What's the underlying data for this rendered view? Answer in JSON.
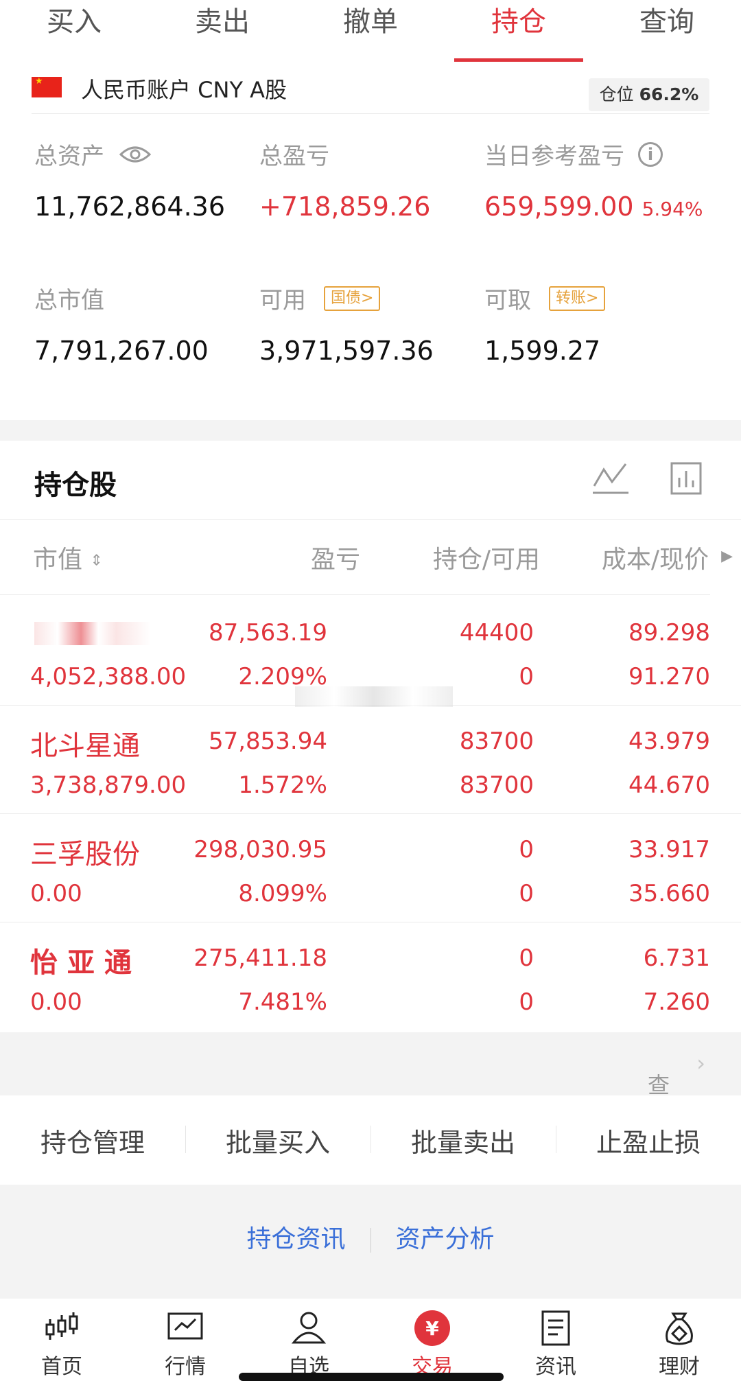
{
  "tabs": [
    {
      "label": "买入"
    },
    {
      "label": "卖出"
    },
    {
      "label": "撤单"
    },
    {
      "label": "持仓"
    },
    {
      "label": "查询"
    }
  ],
  "active_tab": "持仓",
  "account": {
    "label": "人民币账户 CNY A股",
    "position_label": "仓位",
    "position_value": "66.2%"
  },
  "summary": {
    "total_assets_label": "总资产",
    "total_assets": "11,762,864.36",
    "total_pl_label": "总盈亏",
    "total_pl": "+718,859.26",
    "daily_pl_label": "当日参考盈亏",
    "daily_pl": "659,599.00",
    "daily_pl_pct": "5.94%",
    "market_value_label": "总市值",
    "market_value": "7,791,267.00",
    "available_label": "可用",
    "available_tag": "国债>",
    "available": "3,971,597.36",
    "withdrawable_label": "可取",
    "withdrawable_tag": "转账>",
    "withdrawable": "1,599.27"
  },
  "holdings": {
    "title": "持仓股",
    "columns": [
      "市值",
      "盈亏",
      "持仓/可用",
      "成本/现价"
    ],
    "rows": [
      {
        "name": "",
        "market_value": "4,052,388.00",
        "pl": "87,563.19",
        "pl_pct": "2.209%",
        "position": "44400",
        "available": "0",
        "cost": "89.298",
        "price": "91.270"
      },
      {
        "name": "北斗星通",
        "market_value": "3,738,879.00",
        "pl": "57,853.94",
        "pl_pct": "1.572%",
        "position": "83700",
        "available": "83700",
        "cost": "43.979",
        "price": "44.670"
      },
      {
        "name": "三孚股份",
        "market_value": "0.00",
        "pl": "298,030.95",
        "pl_pct": "8.099%",
        "position": "0",
        "available": "0",
        "cost": "33.917",
        "price": "35.660"
      },
      {
        "name": "怡 亚 通",
        "market_value": "0.00",
        "pl": "275,411.18",
        "pl_pct": "7.481%",
        "position": "0",
        "available": "0",
        "cost": "6.731",
        "price": "7.260"
      }
    ],
    "cleared_link": "查看已清仓股票"
  },
  "actions": [
    "持仓管理",
    "批量买入",
    "批量卖出",
    "止盈止损"
  ],
  "links": [
    "持仓资讯",
    "资产分析"
  ],
  "nav": [
    {
      "label": "首页",
      "icon": "candlestick-icon"
    },
    {
      "label": "行情",
      "icon": "chart-icon"
    },
    {
      "label": "自选",
      "icon": "person-icon"
    },
    {
      "label": "交易",
      "icon": "yuan-icon"
    },
    {
      "label": "资讯",
      "icon": "document-icon"
    },
    {
      "label": "理财",
      "icon": "money-bag-icon"
    }
  ],
  "colors": {
    "accent": "#e0343c",
    "link": "#3a6fd8",
    "tag": "#e6a23c"
  }
}
